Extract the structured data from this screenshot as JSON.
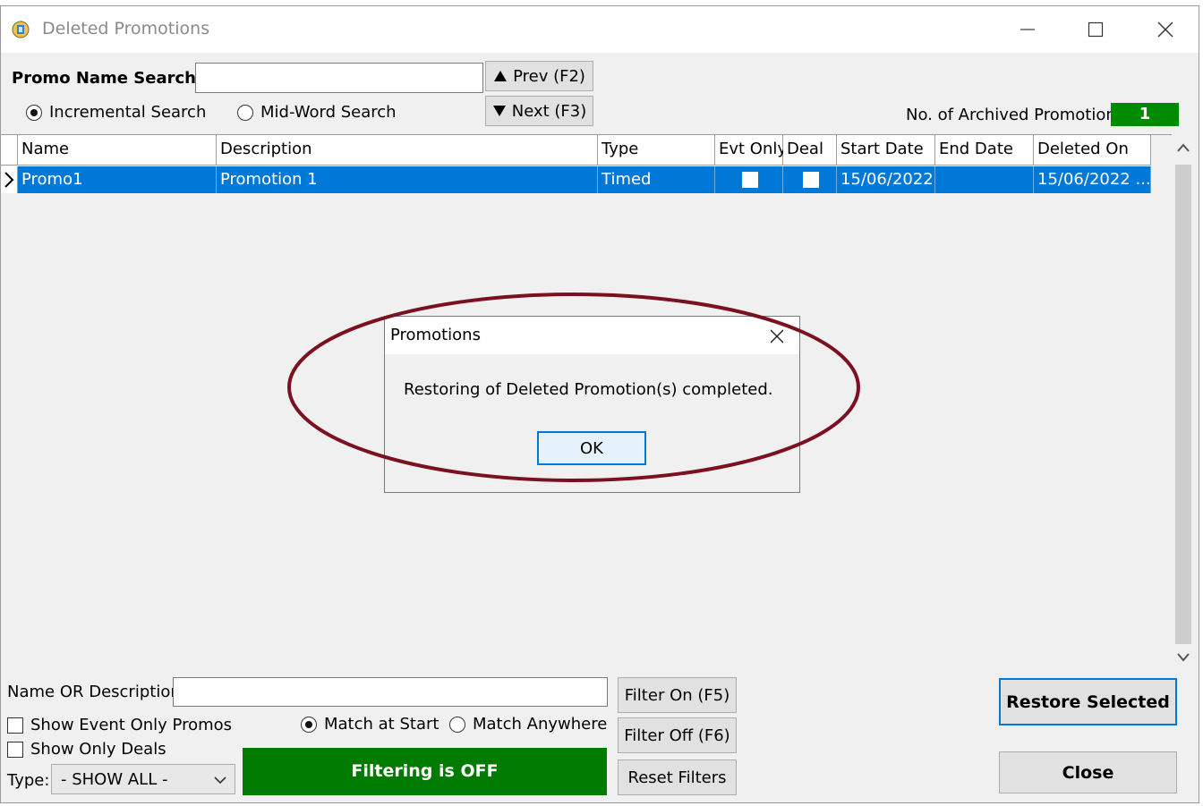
{
  "window": {
    "title": "Deleted Promotions"
  },
  "search": {
    "label": "Promo Name Search",
    "value": "",
    "prev_button": "Prev (F2)",
    "next_button": "Next (F3)",
    "mode_incremental": "Incremental Search",
    "mode_midword": "Mid-Word Search",
    "selected_mode": "Incremental Search"
  },
  "archive": {
    "label": "No. of Archived Promotions:",
    "count": "1",
    "count_color": "#008a00"
  },
  "grid": {
    "columns": [
      "Name",
      "Description",
      "Type",
      "Evt Only",
      "Deal",
      "Start Date",
      "End Date",
      "Deleted On"
    ],
    "rows": [
      {
        "name": "Promo1",
        "description": "Promotion 1",
        "type": "Timed",
        "evt_only": false,
        "deal": false,
        "start_date": "15/06/2022",
        "end_date": "",
        "deleted_on": "15/06/2022 ..."
      }
    ],
    "selection_color": "#0078d7"
  },
  "dialog": {
    "title": "Promotions",
    "message": "Restoring of Deleted Promotion(s) completed.",
    "ok_button": "OK"
  },
  "annotation": {
    "color": "#7b1020"
  },
  "filters": {
    "name_desc_label": "Name OR Description:",
    "name_desc_value": "",
    "show_event_only": "Show Event Only Promos",
    "show_only_deals": "Show Only Deals",
    "match_start": "Match at Start",
    "match_anywhere": "Match Anywhere",
    "type_label": "Type:",
    "type_value": "- SHOW ALL -",
    "status": "Filtering is OFF",
    "status_color": "#007a00",
    "filter_on": "Filter On (F5)",
    "filter_off": "Filter Off (F6)",
    "reset": "Reset Filters"
  },
  "actions": {
    "restore": "Restore Selected",
    "close": "Close"
  }
}
